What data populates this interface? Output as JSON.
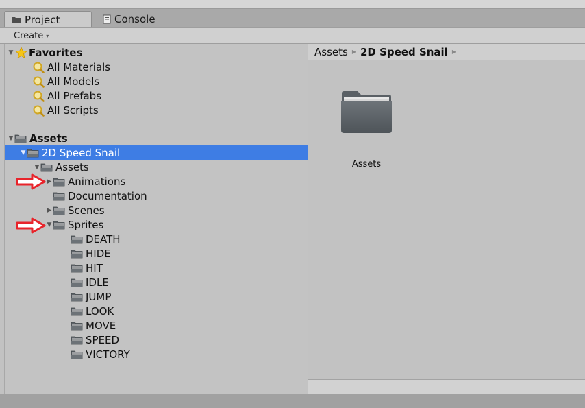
{
  "tabs": [
    {
      "label": "Project",
      "icon": "folder-tab-icon",
      "active": true
    },
    {
      "label": "Console",
      "icon": "console-icon",
      "active": false
    }
  ],
  "toolbar": {
    "create_label": "Create",
    "create_caret": "▾"
  },
  "favorites": {
    "label": "Favorites",
    "items": [
      "All Materials",
      "All Models",
      "All Prefabs",
      "All Scripts"
    ]
  },
  "tree": {
    "assets_root": "Assets",
    "selected": "2D Speed Snail",
    "assets_sub": "Assets",
    "animations": "Animations",
    "documentation": "Documentation",
    "scenes": "Scenes",
    "sprites": "Sprites",
    "sprite_folders": [
      "DEATH",
      "HIDE",
      "HIT",
      "IDLE",
      "JUMP",
      "LOOK",
      "MOVE",
      "SPEED",
      "VICTORY"
    ]
  },
  "breadcrumb": {
    "root": "Assets",
    "current": "2D Speed Snail"
  },
  "content": {
    "folder_label": "Assets"
  },
  "colors": {
    "selection": "#3e7de4",
    "annotation_arrow": "#e8242b",
    "folder": "#5a6168"
  }
}
